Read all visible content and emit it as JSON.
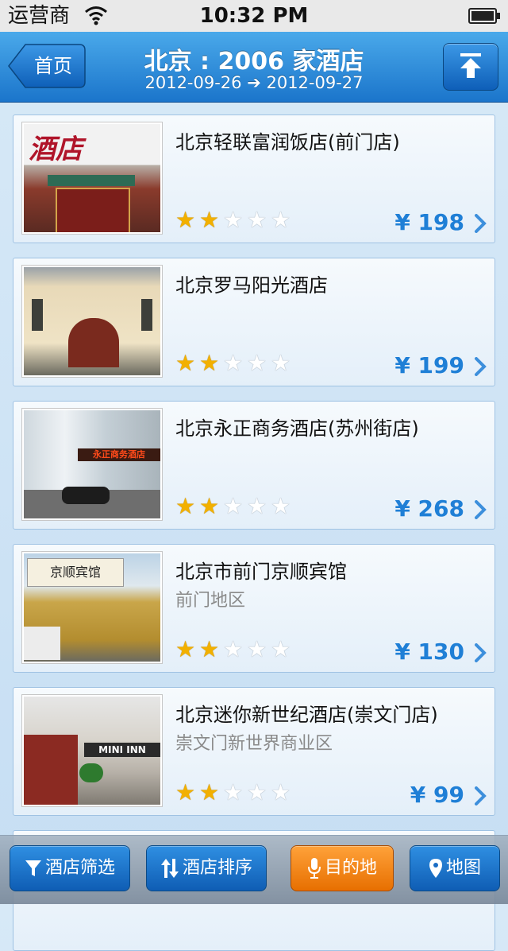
{
  "status_bar": {
    "carrier": "运营商",
    "time": "10:32 PM"
  },
  "nav": {
    "back_label": "首页",
    "title": "北京 : 2006 家酒店",
    "subtitle": "2012-09-26 ➔ 2012-09-27"
  },
  "hotels": [
    {
      "name": "北京轻联富润饭店(前门店)",
      "area": "",
      "stars": 2,
      "max_stars": 5,
      "price": "¥ 198",
      "sign": "酒店 前门店"
    },
    {
      "name": "北京罗马阳光酒店",
      "area": "",
      "stars": 2,
      "max_stars": 5,
      "price": "¥ 199",
      "sign": ""
    },
    {
      "name": "北京永正商务酒店(苏州街店)",
      "area": "",
      "stars": 2,
      "max_stars": 5,
      "price": "¥ 268",
      "sign": "永正商务酒店"
    },
    {
      "name": "北京市前门京顺宾馆",
      "area": "前门地区",
      "stars": 2,
      "max_stars": 5,
      "price": "¥ 130",
      "sign": "京顺宾馆"
    },
    {
      "name": "北京迷你新世纪酒店(崇文门店)",
      "area": "崇文门新世界商业区",
      "stars": 2,
      "max_stars": 5,
      "price": "¥ 99",
      "sign": "MINI INN"
    }
  ],
  "toolbar": {
    "filter_label": "酒店筛选",
    "sort_label": "酒店排序",
    "destination_label": "目的地",
    "map_label": "地图"
  },
  "colors": {
    "nav_blue": "#1b75cb",
    "price_blue": "#1f7fd6",
    "star_gold": "#f2b000",
    "destination_orange": "#e76f00"
  }
}
